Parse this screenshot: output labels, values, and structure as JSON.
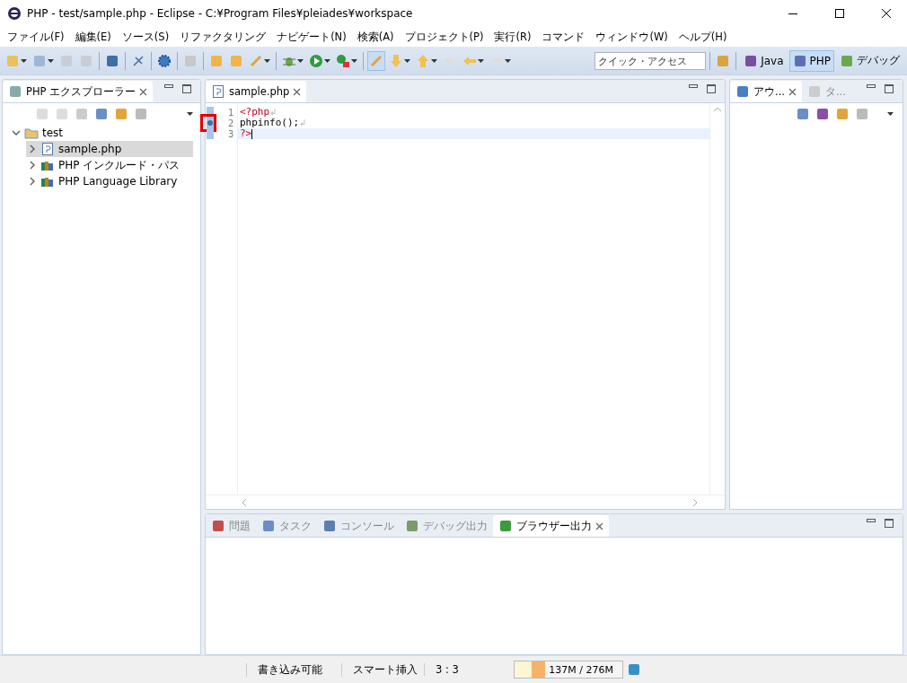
{
  "window": {
    "title": "PHP - test/sample.php - Eclipse - C:¥Program Files¥pleiades¥workspace"
  },
  "menu": [
    "ファイル(F)",
    "編集(E)",
    "ソース(S)",
    "リファクタリング",
    "ナビゲート(N)",
    "検索(A)",
    "プロジェクト(P)",
    "実行(R)",
    "コマンド",
    "ウィンドウ(W)",
    "ヘルプ(H)"
  ],
  "quick_access": {
    "placeholder": "クイック・アクセス"
  },
  "perspectives": [
    {
      "label": "Java",
      "selected": false
    },
    {
      "label": "PHP",
      "selected": true
    },
    {
      "label": "デバッグ",
      "selected": false
    }
  ],
  "explorer": {
    "title": "PHP エクスプローラー",
    "tree": [
      {
        "label": "test",
        "expanded": true,
        "selected": false,
        "kind": "project",
        "children": [
          {
            "label": "sample.php",
            "expanded": false,
            "selected": true,
            "kind": "file"
          },
          {
            "label": "PHP インクルード・パス",
            "expanded": false,
            "selected": false,
            "kind": "library"
          },
          {
            "label": "PHP Language Library",
            "expanded": false,
            "selected": false,
            "kind": "library"
          }
        ]
      }
    ]
  },
  "editor": {
    "tab": "sample.php",
    "lines": [
      {
        "number": "1",
        "text": "<?php",
        "kind": "tag",
        "eol": "↲",
        "current": false,
        "highlighted": false
      },
      {
        "number": "2",
        "text": "phpinfo();",
        "kind": "code",
        "eol": "↲",
        "current": false,
        "highlighted": true
      },
      {
        "number": "3",
        "text": "?>",
        "kind": "tag",
        "current": true,
        "highlighted": false
      }
    ]
  },
  "outline": {
    "tabs": [
      {
        "label": "アウ...",
        "selected": true
      },
      {
        "label": "タ...",
        "selected": false
      }
    ]
  },
  "bottom": {
    "tabs": [
      {
        "label": "問題",
        "selected": false
      },
      {
        "label": "タスク",
        "selected": false
      },
      {
        "label": "コンソール",
        "selected": false
      },
      {
        "label": "デバッグ出力",
        "selected": false
      },
      {
        "label": "ブラウザー出力",
        "selected": true
      }
    ]
  },
  "status_bar": {
    "mode": "書き込み可能",
    "insert": "スマート挿入",
    "position": "3 : 3",
    "memory": {
      "reading": "137M / 276M",
      "level": 0.28
    }
  }
}
